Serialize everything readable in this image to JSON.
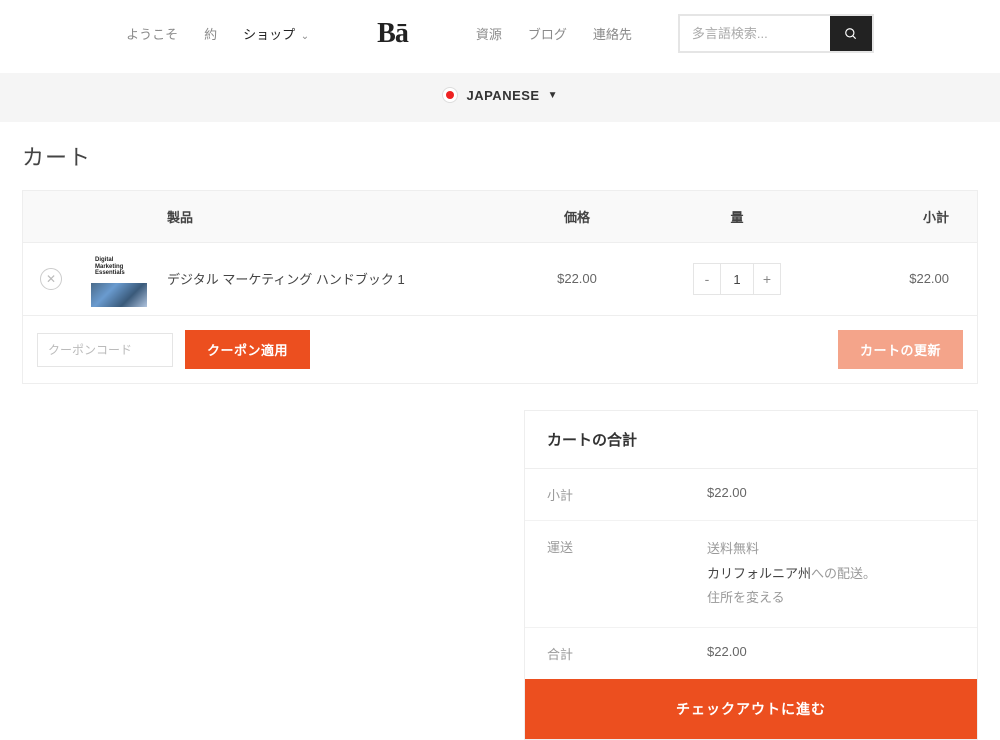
{
  "nav": {
    "left": [
      {
        "label": "ようこそ",
        "active": false,
        "has_dropdown": false
      },
      {
        "label": "約",
        "active": false,
        "has_dropdown": false
      },
      {
        "label": "ショップ",
        "active": true,
        "has_dropdown": true
      }
    ],
    "logo": "Bā",
    "right": [
      {
        "label": "資源"
      },
      {
        "label": "ブログ"
      },
      {
        "label": "連絡先"
      }
    ],
    "search_placeholder": "多言語検索..."
  },
  "language": {
    "label": "JAPANESE",
    "caret": "▼"
  },
  "page_title": "カート",
  "cart": {
    "headers": {
      "product": "製品",
      "price": "価格",
      "qty": "量",
      "subtotal": "小計"
    },
    "items": [
      {
        "thumb_lines": "Digital\nMarketing\nEssentials",
        "name": "デジタル マーケティング ハンドブック 1",
        "price": "$22.00",
        "qty": "1",
        "subtotal": "$22.00"
      }
    ],
    "coupon_placeholder": "クーポンコード",
    "apply_coupon": "クーポン適用",
    "update_cart": "カートの更新"
  },
  "totals": {
    "title": "カートの合計",
    "subtotal_label": "小計",
    "subtotal_value": "$22.00",
    "shipping_label": "運送",
    "shipping_free": "送料無料",
    "shipping_dest_prefix": "カリフォルニア州",
    "shipping_dest_suffix": "への配送。",
    "change_address": "住所を変える",
    "total_label": "合計",
    "total_value": "$22.00",
    "checkout": "チェックアウトに進む"
  }
}
